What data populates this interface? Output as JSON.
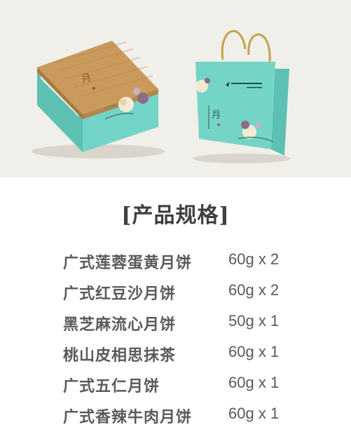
{
  "section_title": "[产品规格]",
  "specs": [
    {
      "name": "广式莲蓉蛋黄月饼",
      "qty": "60g x 2"
    },
    {
      "name": "广式红豆沙月饼",
      "qty": "60g x 2"
    },
    {
      "name": "黑芝麻流心月饼",
      "qty": "50g x 1"
    },
    {
      "name": "桃山皮相思抹茶",
      "qty": "60g x 1"
    },
    {
      "name": "广式五仁月饼",
      "qty": "60g x 1"
    },
    {
      "name": "广式香辣牛肉月饼",
      "qty": "60g x 1"
    }
  ],
  "colors": {
    "teal": "#6fd3c5",
    "wood": "#c9995a",
    "text": "#5a5a5a",
    "hero_bg": "#f1efea"
  },
  "hero_icons": [
    "gift-box-icon",
    "gift-bag-icon"
  ]
}
